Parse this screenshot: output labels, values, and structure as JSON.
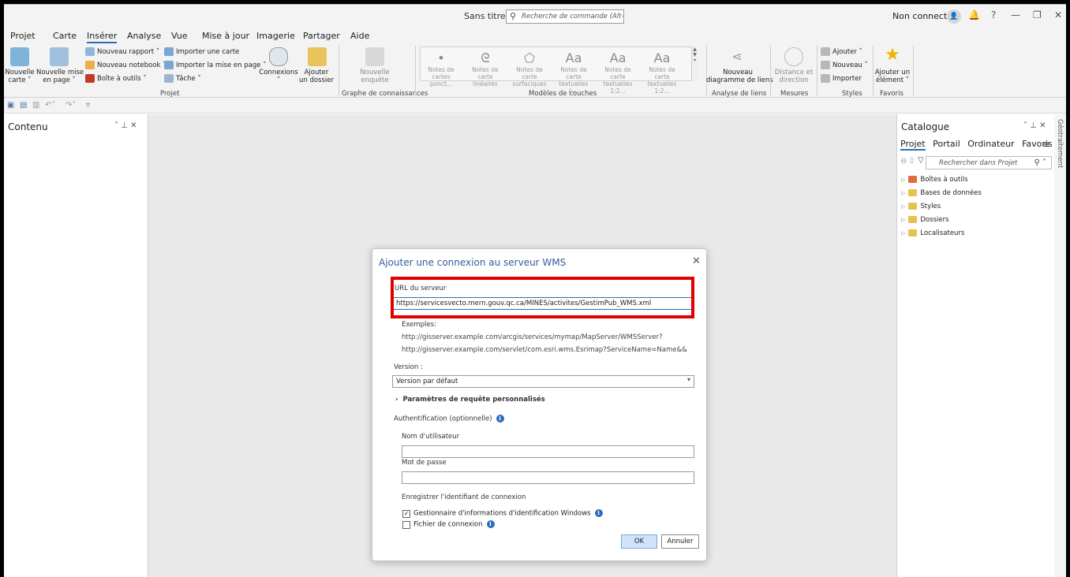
{
  "titlebar": {
    "doc_title": "Sans titre",
    "search_placeholder": "Recherche de commande (Alt+Q)",
    "signin": "Non connecté",
    "help": "?"
  },
  "tabs": [
    "Projet",
    "Carte",
    "Insérer",
    "Analyse",
    "Vue",
    "Mise à jour",
    "Imagerie",
    "Partager",
    "Aide"
  ],
  "active_tab": "Insérer",
  "ribbon": {
    "new_map_1": "Nouvelle",
    "new_map_2": "carte ˅",
    "new_layout_1": "Nouvelle mise",
    "new_layout_2": "en page ˅",
    "new_report": "Nouveau rapport ˅",
    "new_notebook": "Nouveau notebook ˅",
    "toolbox": "Boîte à outils ˅",
    "import_map": "Importer une carte",
    "import_layout": "Importer la mise en page ˅",
    "task": "Tâche ˅",
    "connections": "Connexions",
    "connections_caret": "˅",
    "add_folder_1": "Ajouter",
    "add_folder_2": "un dossier",
    "group_project": "Projet",
    "new_survey_1": "Nouvelle",
    "new_survey_2": "enquête",
    "group_knowledge": "Graphe de connaissances",
    "layer_templates": [
      {
        "l1": "Notes de",
        "l2": "cartes ponct...",
        "glyph": "•"
      },
      {
        "l1": "Notes de carte",
        "l2": "linéaires",
        "glyph": "ᘓ"
      },
      {
        "l1": "Notes de carte",
        "l2": "surfaciques",
        "glyph": "⬠"
      },
      {
        "l1": "Notes de carte",
        "l2": "textuelles (:...",
        "glyph": "Aa"
      },
      {
        "l1": "Notes de carte",
        "l2": "textuelles 1:2...",
        "glyph": "Aa"
      },
      {
        "l1": "Notes de carte",
        "l2": "textuelles 1:2...",
        "glyph": "Aa"
      }
    ],
    "group_layer_templates": "Modèles de couches",
    "new_link_chart_1": "Nouveau",
    "new_link_chart_2": "diagramme de liens",
    "group_link_analysis": "Analyse de liens",
    "distance_1": "Distance et",
    "distance_2": "direction",
    "group_measures": "Mesures",
    "styles_add": "Ajouter ˅",
    "styles_new": "Nouveau ˅",
    "styles_import": "Importer",
    "group_styles": "Styles",
    "add_item_1": "Ajouter un",
    "add_item_2": "élément ˅",
    "group_favorites": "Favoris"
  },
  "contents": {
    "title": "Contenu",
    "controls": "˅  ⊥  ✕"
  },
  "catalog": {
    "title": "Catalogue",
    "controls": "˅  ⊥  ✕",
    "tabs": [
      "Projet",
      "Portail",
      "Ordinateur",
      "Favoris"
    ],
    "search_placeholder": "Rechercher dans Projet",
    "items": [
      "Boîtes à outils",
      "Bases de données",
      "Styles",
      "Dossiers",
      "Localisateurs"
    ],
    "side_label": "Géotraitement"
  },
  "dialog": {
    "title": "Ajouter une connexion au serveur WMS",
    "url_label": "URL du serveur",
    "url_value": "https://servicesvecto.mern.gouv.qc.ca/MINES/activites/GestimPub_WMS.xml",
    "examples_label": "Exemples:",
    "example_1": "http://gisserver.example.com/arcgis/services/mymap/MapServer/WMSServer?",
    "example_2": "http://gisserver.example.com/servlet/com.esri.wms.Esrimap?ServiceName=Name&&",
    "version_label": "Version :",
    "version_value": "Version par défaut",
    "custom_params": "Paramètres de requête personnalisés",
    "auth_label": "Authentification (optionnelle)",
    "username_label": "Nom d'utilisateur",
    "username_value": "",
    "password_label": "Mot de passe",
    "password_value": "",
    "save_cred_label": "Enregistrer l'identifiant de connexion",
    "cred_manager_label": "Gestionnaire d'informations d'identification Windows",
    "cred_manager_checked": true,
    "connection_file_label": "Fichier de connexion",
    "connection_file_checked": false,
    "ok": "OK",
    "cancel": "Annuler"
  },
  "colors": {
    "accent": "#2a6ebb",
    "highlight": "#e00000"
  }
}
